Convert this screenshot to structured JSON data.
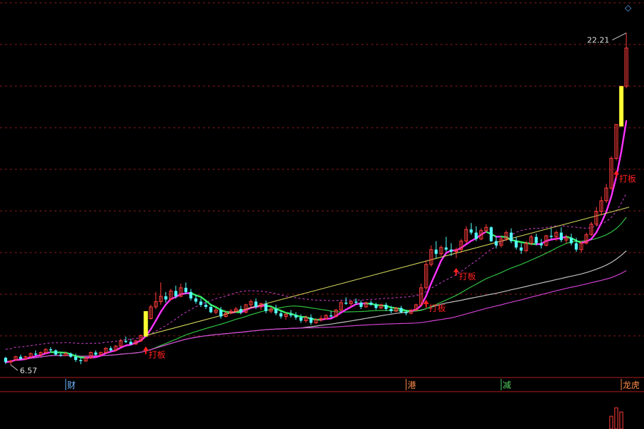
{
  "chart_data": {
    "type": "candlestick",
    "price_annotations": {
      "low": "6.57",
      "high": "22.21"
    },
    "signal_label": "打板",
    "event_markers": [
      {
        "text": "财",
        "color": "#6fb8ff"
      },
      {
        "text": "港",
        "color": "#ff8c4a"
      },
      {
        "text": "减",
        "color": "#50d060"
      },
      {
        "text": "龙虎",
        "color": "#ff8c4a"
      }
    ],
    "candles": [
      [
        6.9,
        6.95,
        6.6,
        6.7
      ],
      [
        6.7,
        6.8,
        6.57,
        6.75
      ],
      [
        6.8,
        7.0,
        6.75,
        6.95
      ],
      [
        6.95,
        7.05,
        6.8,
        6.85
      ],
      [
        6.85,
        7.0,
        6.8,
        6.95
      ],
      [
        6.95,
        7.15,
        6.9,
        7.1
      ],
      [
        7.1,
        7.25,
        7.0,
        7.05
      ],
      [
        7.05,
        7.2,
        6.95,
        7.15
      ],
      [
        7.15,
        7.35,
        7.1,
        7.3
      ],
      [
        7.3,
        7.4,
        7.2,
        7.25
      ],
      [
        7.25,
        7.3,
        7.0,
        7.05
      ],
      [
        7.05,
        7.15,
        6.95,
        7.0
      ],
      [
        7.0,
        7.2,
        6.98,
        7.1
      ],
      [
        7.1,
        7.15,
        6.9,
        6.95
      ],
      [
        6.95,
        7.1,
        6.7,
        6.8
      ],
      [
        6.8,
        6.9,
        6.6,
        6.75
      ],
      [
        6.75,
        6.95,
        6.7,
        6.9
      ],
      [
        6.9,
        7.2,
        6.85,
        7.15
      ],
      [
        7.15,
        7.25,
        7.0,
        7.05
      ],
      [
        7.05,
        7.2,
        7.0,
        7.15
      ],
      [
        7.15,
        7.4,
        7.1,
        7.35
      ],
      [
        7.35,
        7.45,
        7.2,
        7.25
      ],
      [
        7.25,
        7.5,
        7.2,
        7.45
      ],
      [
        7.45,
        7.8,
        7.4,
        7.7
      ],
      [
        7.7,
        7.9,
        7.6,
        7.65
      ],
      [
        7.65,
        7.8,
        7.5,
        7.55
      ],
      [
        7.55,
        7.75,
        7.5,
        7.7
      ],
      [
        7.7,
        8.0,
        7.65,
        7.95
      ],
      [
        7.95,
        9.1,
        7.9,
        8.75
      ],
      [
        8.75,
        9.4,
        8.7,
        9.3
      ],
      [
        9.3,
        10.0,
        9.2,
        9.55
      ],
      [
        9.55,
        10.45,
        9.4,
        9.8
      ],
      [
        9.8,
        10.0,
        9.5,
        9.65
      ],
      [
        9.65,
        10.15,
        9.6,
        10.05
      ],
      [
        10.05,
        10.3,
        9.7,
        9.8
      ],
      [
        9.8,
        10.4,
        9.75,
        10.2
      ],
      [
        10.2,
        10.45,
        9.9,
        10.0
      ],
      [
        10.0,
        10.15,
        9.6,
        9.7
      ],
      [
        9.7,
        9.85,
        9.45,
        9.55
      ],
      [
        9.55,
        9.7,
        9.3,
        9.4
      ],
      [
        9.4,
        9.55,
        9.2,
        9.3
      ],
      [
        9.3,
        9.4,
        9.0,
        9.05
      ],
      [
        9.05,
        9.25,
        8.95,
        9.15
      ],
      [
        9.15,
        9.3,
        8.75,
        8.85
      ],
      [
        8.85,
        9.1,
        8.8,
        9.0
      ],
      [
        9.0,
        9.2,
        8.95,
        9.1
      ],
      [
        9.1,
        9.3,
        9.05,
        9.2
      ],
      [
        9.2,
        9.35,
        8.95,
        9.05
      ],
      [
        9.05,
        9.45,
        9.0,
        9.4
      ],
      [
        9.4,
        9.65,
        9.3,
        9.55
      ],
      [
        9.55,
        9.7,
        9.2,
        9.3
      ],
      [
        9.3,
        9.5,
        9.15,
        9.45
      ],
      [
        9.45,
        9.6,
        9.0,
        9.1
      ],
      [
        9.1,
        9.3,
        9.0,
        9.2
      ],
      [
        9.2,
        9.4,
        8.9,
        9.0
      ],
      [
        9.0,
        9.1,
        8.75,
        8.85
      ],
      [
        8.85,
        9.05,
        8.7,
        8.95
      ],
      [
        8.95,
        9.15,
        8.8,
        8.9
      ],
      [
        8.9,
        9.05,
        8.7,
        8.8
      ],
      [
        8.8,
        8.95,
        8.55,
        8.65
      ],
      [
        8.65,
        8.9,
        8.55,
        8.8
      ],
      [
        8.8,
        8.95,
        8.45,
        8.55
      ],
      [
        8.55,
        8.75,
        8.5,
        8.7
      ],
      [
        8.7,
        8.9,
        8.6,
        8.75
      ],
      [
        8.75,
        8.95,
        8.7,
        8.9
      ],
      [
        8.9,
        9.1,
        8.8,
        8.85
      ],
      [
        8.85,
        9.2,
        8.8,
        9.15
      ],
      [
        9.15,
        9.6,
        9.1,
        9.5
      ],
      [
        9.5,
        9.75,
        9.4,
        9.45
      ],
      [
        9.45,
        9.6,
        9.3,
        9.55
      ],
      [
        9.55,
        9.7,
        9.4,
        9.5
      ],
      [
        9.5,
        9.6,
        9.2,
        9.3
      ],
      [
        9.3,
        9.55,
        9.25,
        9.5
      ],
      [
        9.5,
        9.6,
        9.35,
        9.4
      ],
      [
        9.4,
        9.5,
        9.15,
        9.25
      ],
      [
        9.25,
        9.45,
        9.2,
        9.4
      ],
      [
        9.4,
        9.5,
        9.1,
        9.2
      ],
      [
        9.2,
        9.35,
        9.0,
        9.1
      ],
      [
        9.1,
        9.3,
        9.05,
        9.25
      ],
      [
        9.25,
        9.35,
        9.0,
        9.05
      ],
      [
        9.05,
        9.15,
        8.9,
        9.0
      ],
      [
        9.0,
        9.2,
        8.95,
        9.15
      ],
      [
        9.15,
        9.45,
        9.1,
        9.4
      ],
      [
        9.4,
        10.4,
        9.35,
        10.2
      ],
      [
        10.2,
        11.5,
        10.1,
        11.3
      ],
      [
        11.3,
        12.2,
        11.2,
        12.0
      ],
      [
        12.0,
        12.4,
        11.6,
        11.8
      ],
      [
        11.8,
        12.2,
        11.7,
        12.1
      ],
      [
        12.1,
        12.6,
        11.9,
        12.0
      ],
      [
        12.0,
        12.3,
        11.7,
        11.9
      ],
      [
        11.9,
        12.1,
        11.6,
        12.0
      ],
      [
        12.0,
        12.5,
        11.9,
        12.4
      ],
      [
        12.4,
        13.1,
        12.3,
        12.95
      ],
      [
        12.95,
        13.25,
        12.7,
        12.8
      ],
      [
        12.8,
        13.1,
        12.4,
        12.5
      ],
      [
        12.5,
        13.0,
        12.45,
        12.9
      ],
      [
        12.9,
        13.2,
        12.8,
        13.05
      ],
      [
        13.05,
        13.1,
        12.35,
        12.4
      ],
      [
        12.4,
        12.6,
        12.05,
        12.2
      ],
      [
        12.2,
        12.6,
        12.1,
        12.5
      ],
      [
        12.5,
        12.9,
        12.4,
        12.8
      ],
      [
        12.8,
        13.0,
        12.3,
        12.4
      ],
      [
        12.4,
        12.6,
        12.0,
        12.1
      ],
      [
        12.1,
        12.3,
        11.8,
        11.95
      ],
      [
        11.95,
        12.4,
        11.9,
        12.3
      ],
      [
        12.3,
        12.7,
        12.2,
        12.6
      ],
      [
        12.6,
        12.75,
        12.2,
        12.3
      ],
      [
        12.3,
        12.5,
        12.05,
        12.2
      ],
      [
        12.2,
        12.7,
        12.15,
        12.65
      ],
      [
        12.65,
        13.0,
        12.5,
        12.6
      ],
      [
        12.6,
        12.9,
        12.4,
        12.8
      ],
      [
        12.8,
        13.05,
        12.35,
        12.45
      ],
      [
        12.45,
        12.7,
        12.3,
        12.55
      ],
      [
        12.55,
        12.75,
        12.2,
        12.3
      ],
      [
        12.3,
        12.55,
        11.9,
        12.0
      ],
      [
        12.0,
        12.4,
        11.85,
        12.3
      ],
      [
        12.3,
        12.8,
        12.25,
        12.7
      ],
      [
        12.7,
        13.3,
        12.65,
        13.2
      ],
      [
        13.2,
        14.0,
        13.1,
        13.8
      ],
      [
        13.8,
        14.5,
        13.6,
        14.3
      ],
      [
        14.3,
        15.1,
        14.2,
        14.9
      ],
      [
        14.9,
        16.4,
        14.8,
        16.3
      ],
      [
        16.3,
        17.9,
        16.2,
        17.9
      ],
      [
        17.9,
        19.7,
        17.8,
        19.7
      ],
      [
        19.7,
        22.21,
        19.6,
        21.5
      ]
    ]
  }
}
